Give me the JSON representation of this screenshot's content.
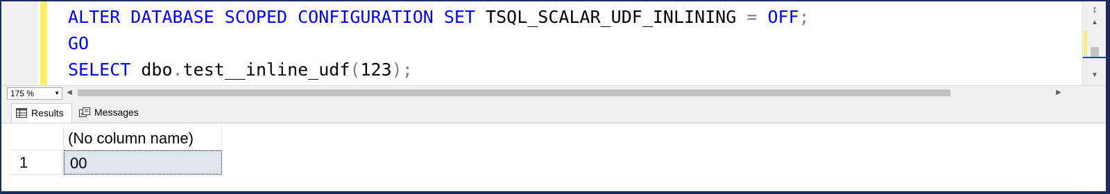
{
  "editor": {
    "lines": [
      [
        {
          "text": "ALTER DATABASE SCOPED CONFIGURATION SET",
          "cls": "kw"
        },
        {
          "text": " TSQL_SCALAR_UDF_INLINING ",
          "cls": ""
        },
        {
          "text": "=",
          "cls": "op"
        },
        {
          "text": " ",
          "cls": ""
        },
        {
          "text": "OFF",
          "cls": "kw"
        },
        {
          "text": ";",
          "cls": "op"
        }
      ],
      [
        {
          "text": "GO",
          "cls": "kw"
        }
      ],
      [
        {
          "text": "SELECT",
          "cls": "kw"
        },
        {
          "text": " dbo",
          "cls": ""
        },
        {
          "text": ".",
          "cls": "op"
        },
        {
          "text": "test__inline_udf",
          "cls": ""
        },
        {
          "text": "(",
          "cls": "op"
        },
        {
          "text": "123",
          "cls": ""
        },
        {
          "text": ");",
          "cls": "op"
        }
      ]
    ],
    "colors": {
      "keyword": "#0000ff",
      "operator": "#808080",
      "change_bar": "#ffee62"
    }
  },
  "status": {
    "zoom": "175 %"
  },
  "tabs": [
    {
      "label": "Results",
      "icon": "grid-icon",
      "active": true
    },
    {
      "label": "Messages",
      "icon": "messages-icon",
      "active": false
    }
  ],
  "results": {
    "columns": [
      "(No column name)"
    ],
    "rows": [
      {
        "num": "1",
        "values": [
          "00"
        ]
      }
    ]
  }
}
